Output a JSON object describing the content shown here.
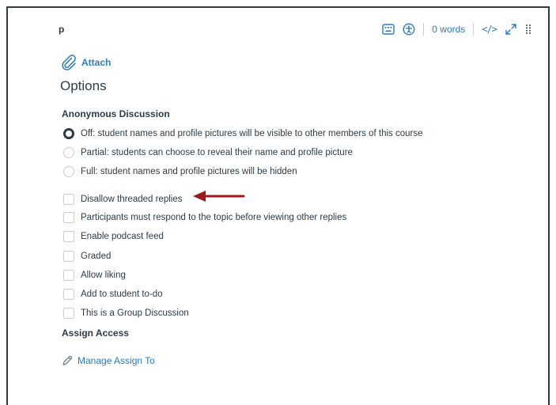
{
  "editor": {
    "path": "p",
    "word_count": "0 words",
    "html_toggle": "</>"
  },
  "attach": {
    "label": "Attach"
  },
  "options": {
    "title": "Options",
    "anonymous": {
      "heading": "Anonymous Discussion",
      "choices": [
        {
          "label": "Off: student names and profile pictures will be visible to other members of this course",
          "selected": true
        },
        {
          "label": "Partial: students can choose to reveal their name and profile picture",
          "selected": false
        },
        {
          "label": "Full: student names and profile pictures will be hidden",
          "selected": false
        }
      ]
    },
    "checkboxes": [
      {
        "label": "Disallow threaded replies",
        "checked": false
      },
      {
        "label": "Participants must respond to the topic before viewing other replies",
        "checked": false
      },
      {
        "label": "Enable podcast feed",
        "checked": false
      },
      {
        "label": "Graded",
        "checked": false
      },
      {
        "label": "Allow liking",
        "checked": false
      },
      {
        "label": "Add to student to-do",
        "checked": false
      },
      {
        "label": "This is a Group Discussion",
        "checked": false
      }
    ],
    "assign_access": {
      "heading": "Assign Access",
      "link": "Manage Assign To"
    }
  },
  "colors": {
    "link": "#2b7abc",
    "text": "#2d3b45",
    "arrow": "#9b1b1b"
  },
  "icons": [
    "keyboard-icon",
    "accessibility-icon",
    "expand-icon",
    "drag-handle-icon",
    "paperclip-icon",
    "pencil-icon",
    "arrow-left-icon"
  ]
}
